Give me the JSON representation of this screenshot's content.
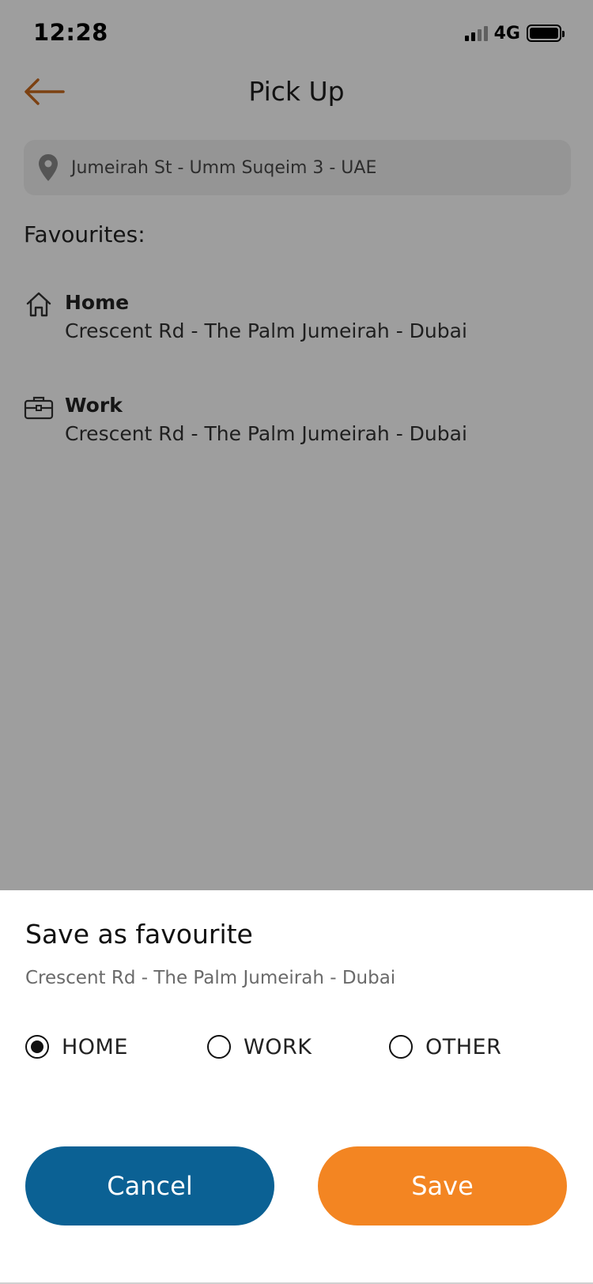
{
  "status_bar": {
    "time": "12:28",
    "network": "4G"
  },
  "header": {
    "title": "Pick Up"
  },
  "search": {
    "value": "Jumeirah St - Umm Suqeim 3 - UAE"
  },
  "favourites": {
    "heading": "Favourites:",
    "items": [
      {
        "label": "Home",
        "address": "Crescent Rd - The Palm Jumeirah - Dubai",
        "icon": "home-icon"
      },
      {
        "label": "Work",
        "address": "Crescent Rd - The Palm Jumeirah - Dubai",
        "icon": "briefcase-icon"
      }
    ]
  },
  "sheet": {
    "title": "Save as favourite",
    "address": "Crescent Rd - The Palm Jumeirah - Dubai",
    "options": [
      {
        "label": "HOME",
        "selected": true
      },
      {
        "label": "WORK",
        "selected": false
      },
      {
        "label": "OTHER",
        "selected": false
      }
    ],
    "cancel_label": "Cancel",
    "save_label": "Save"
  },
  "colors": {
    "accent": "#f38522",
    "primary": "#0b6194",
    "back_arrow": "#c96a1d"
  }
}
